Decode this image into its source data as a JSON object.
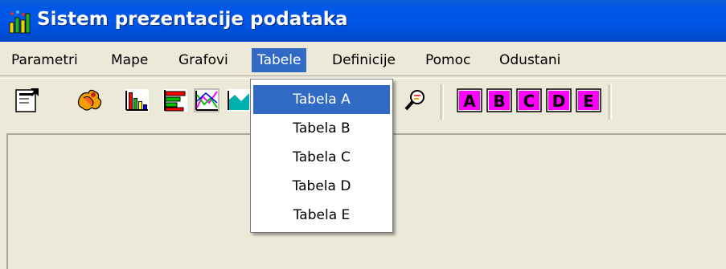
{
  "window": {
    "title": "Sistem prezentacije podataka",
    "title_bar_color": "#0055e5",
    "icon": "bar-chart-app-icon"
  },
  "menubar": {
    "items": [
      {
        "label": "Parametri"
      },
      {
        "label": "Mape"
      },
      {
        "label": "Grafovi"
      },
      {
        "label": "Tabele",
        "active": true
      },
      {
        "label": "Definicije"
      },
      {
        "label": "Pomoc"
      },
      {
        "label": "Odustani"
      }
    ]
  },
  "toolbar": {
    "buttons": [
      {
        "icon": "properties-icon"
      },
      {
        "icon": "puzzle-icon"
      },
      {
        "icon": "bar-chart-icon"
      },
      {
        "icon": "horizontal-bar-chart-icon"
      },
      {
        "icon": "line-chart-icon"
      },
      {
        "icon": "area-chart-icon"
      },
      {
        "icon": "magnifier-icon"
      },
      {
        "icon": "table-a-icon"
      },
      {
        "icon": "table-b-icon"
      },
      {
        "icon": "table-c-icon"
      },
      {
        "icon": "table-d-icon"
      },
      {
        "icon": "table-e-icon"
      }
    ]
  },
  "dropdown": {
    "items": [
      {
        "label": "Tabela A",
        "selected": true
      },
      {
        "label": "Tabela B"
      },
      {
        "label": "Tabela C"
      },
      {
        "label": "Tabela D"
      },
      {
        "label": "Tabela E"
      }
    ]
  },
  "colors": {
    "selection": "#316ac5",
    "window_background": "#ece9d8",
    "table_icon_magenta": "#ff00ff"
  }
}
